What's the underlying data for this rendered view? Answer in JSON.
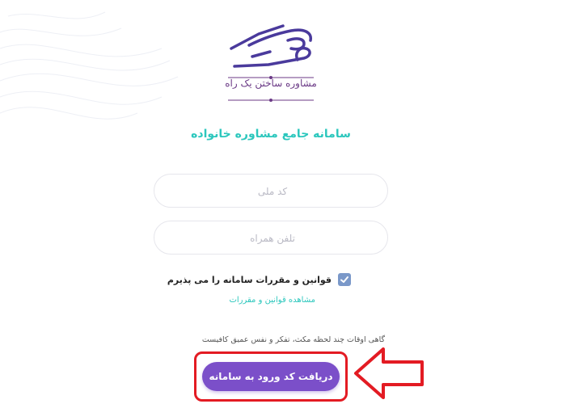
{
  "brand": {
    "logo_caption": "مشاوره ساختن یک راه"
  },
  "title": "سامانه جامع مشاوره خانواده",
  "form": {
    "national_code_placeholder": "کد ملی",
    "phone_placeholder": "تلفن همراه",
    "terms_checked": true,
    "terms_label": "قوانین و مقررات سامانه را می پذیرم",
    "terms_link": "مشاهده قوانین و مقررات"
  },
  "quote": "گاهی اوقات چند لحظه مکث، تفکر و نفس عمیق کافیست",
  "submit_label": "دریافت کد ورود به سامانه",
  "colors": {
    "accent_teal": "#2cc7bd",
    "button_purple": "#7b4fc9",
    "highlight_red": "#e31b23",
    "logo_purple": "#4a3a9c"
  }
}
